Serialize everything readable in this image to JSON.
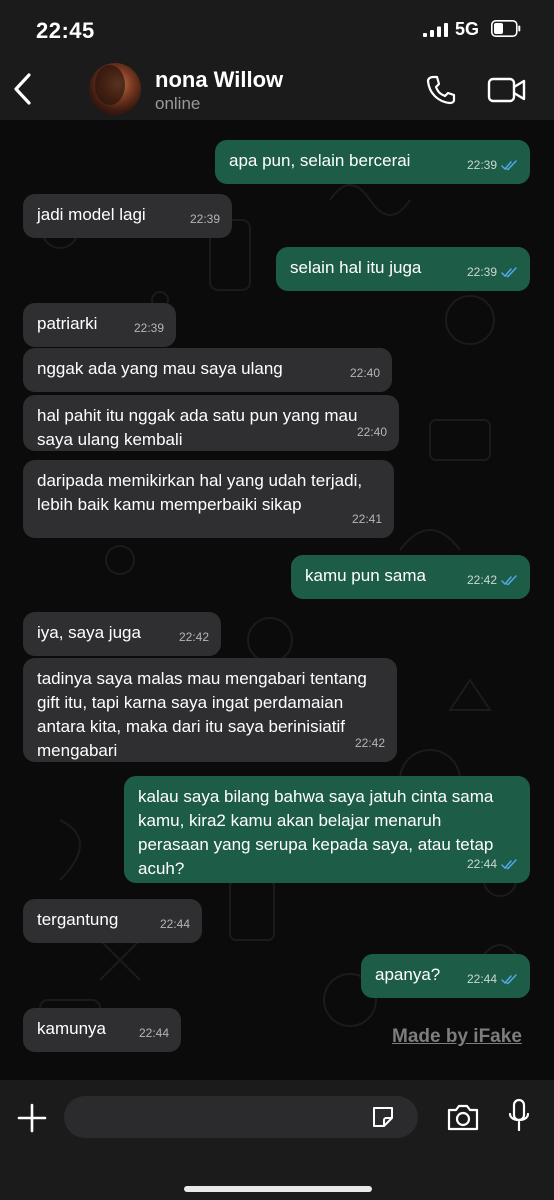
{
  "status_bar": {
    "time": "22:45",
    "network": "5G"
  },
  "header": {
    "name": "nona Willow",
    "status": "online"
  },
  "messages": [
    {
      "dir": "out",
      "text": "apa pun, selain bercerai",
      "time": "22:39"
    },
    {
      "dir": "in",
      "text": "jadi model lagi",
      "time": "22:39"
    },
    {
      "dir": "out",
      "text": "selain hal itu juga",
      "time": "22:39"
    },
    {
      "dir": "in",
      "text": "patriarki",
      "time": "22:39"
    },
    {
      "dir": "in",
      "text": "nggak ada yang mau saya ulang",
      "time": "22:40"
    },
    {
      "dir": "in",
      "text": "hal pahit itu nggak ada satu pun yang mau saya ulang kembali",
      "time": "22:40"
    },
    {
      "dir": "in",
      "text": "daripada memikirkan hal yang udah terjadi, lebih baik kamu memperbaiki sikap",
      "time": "22:41"
    },
    {
      "dir": "out",
      "text": "kamu pun sama",
      "time": "22:42"
    },
    {
      "dir": "in",
      "text": "iya, saya juga",
      "time": "22:42"
    },
    {
      "dir": "in",
      "text": "tadinya saya malas mau mengabari tentang gift itu, tapi karna saya ingat perdamaian antara kita, maka dari itu saya berinisiatif mengabari",
      "time": "22:42"
    },
    {
      "dir": "out",
      "text": "kalau saya bilang bahwa saya jatuh cinta sama kamu, kira2 kamu akan belajar menaruh perasaan yang serupa kepada saya, atau tetap acuh?",
      "time": "22:44"
    },
    {
      "dir": "in",
      "text": "tergantung",
      "time": "22:44"
    },
    {
      "dir": "out",
      "text": "apanya?",
      "time": "22:44"
    },
    {
      "dir": "in",
      "text": "kamunya",
      "time": "22:44"
    }
  ],
  "watermark": "Made by iFake",
  "icons": [
    "back-chevron-icon",
    "phone-icon",
    "video-icon",
    "plus-icon",
    "sticker-icon",
    "camera-icon",
    "mic-icon",
    "read-receipt-icon"
  ],
  "colors": {
    "incoming": "#2f2f31",
    "outgoing": "#1d5d47",
    "tick": "#53a6e8"
  }
}
